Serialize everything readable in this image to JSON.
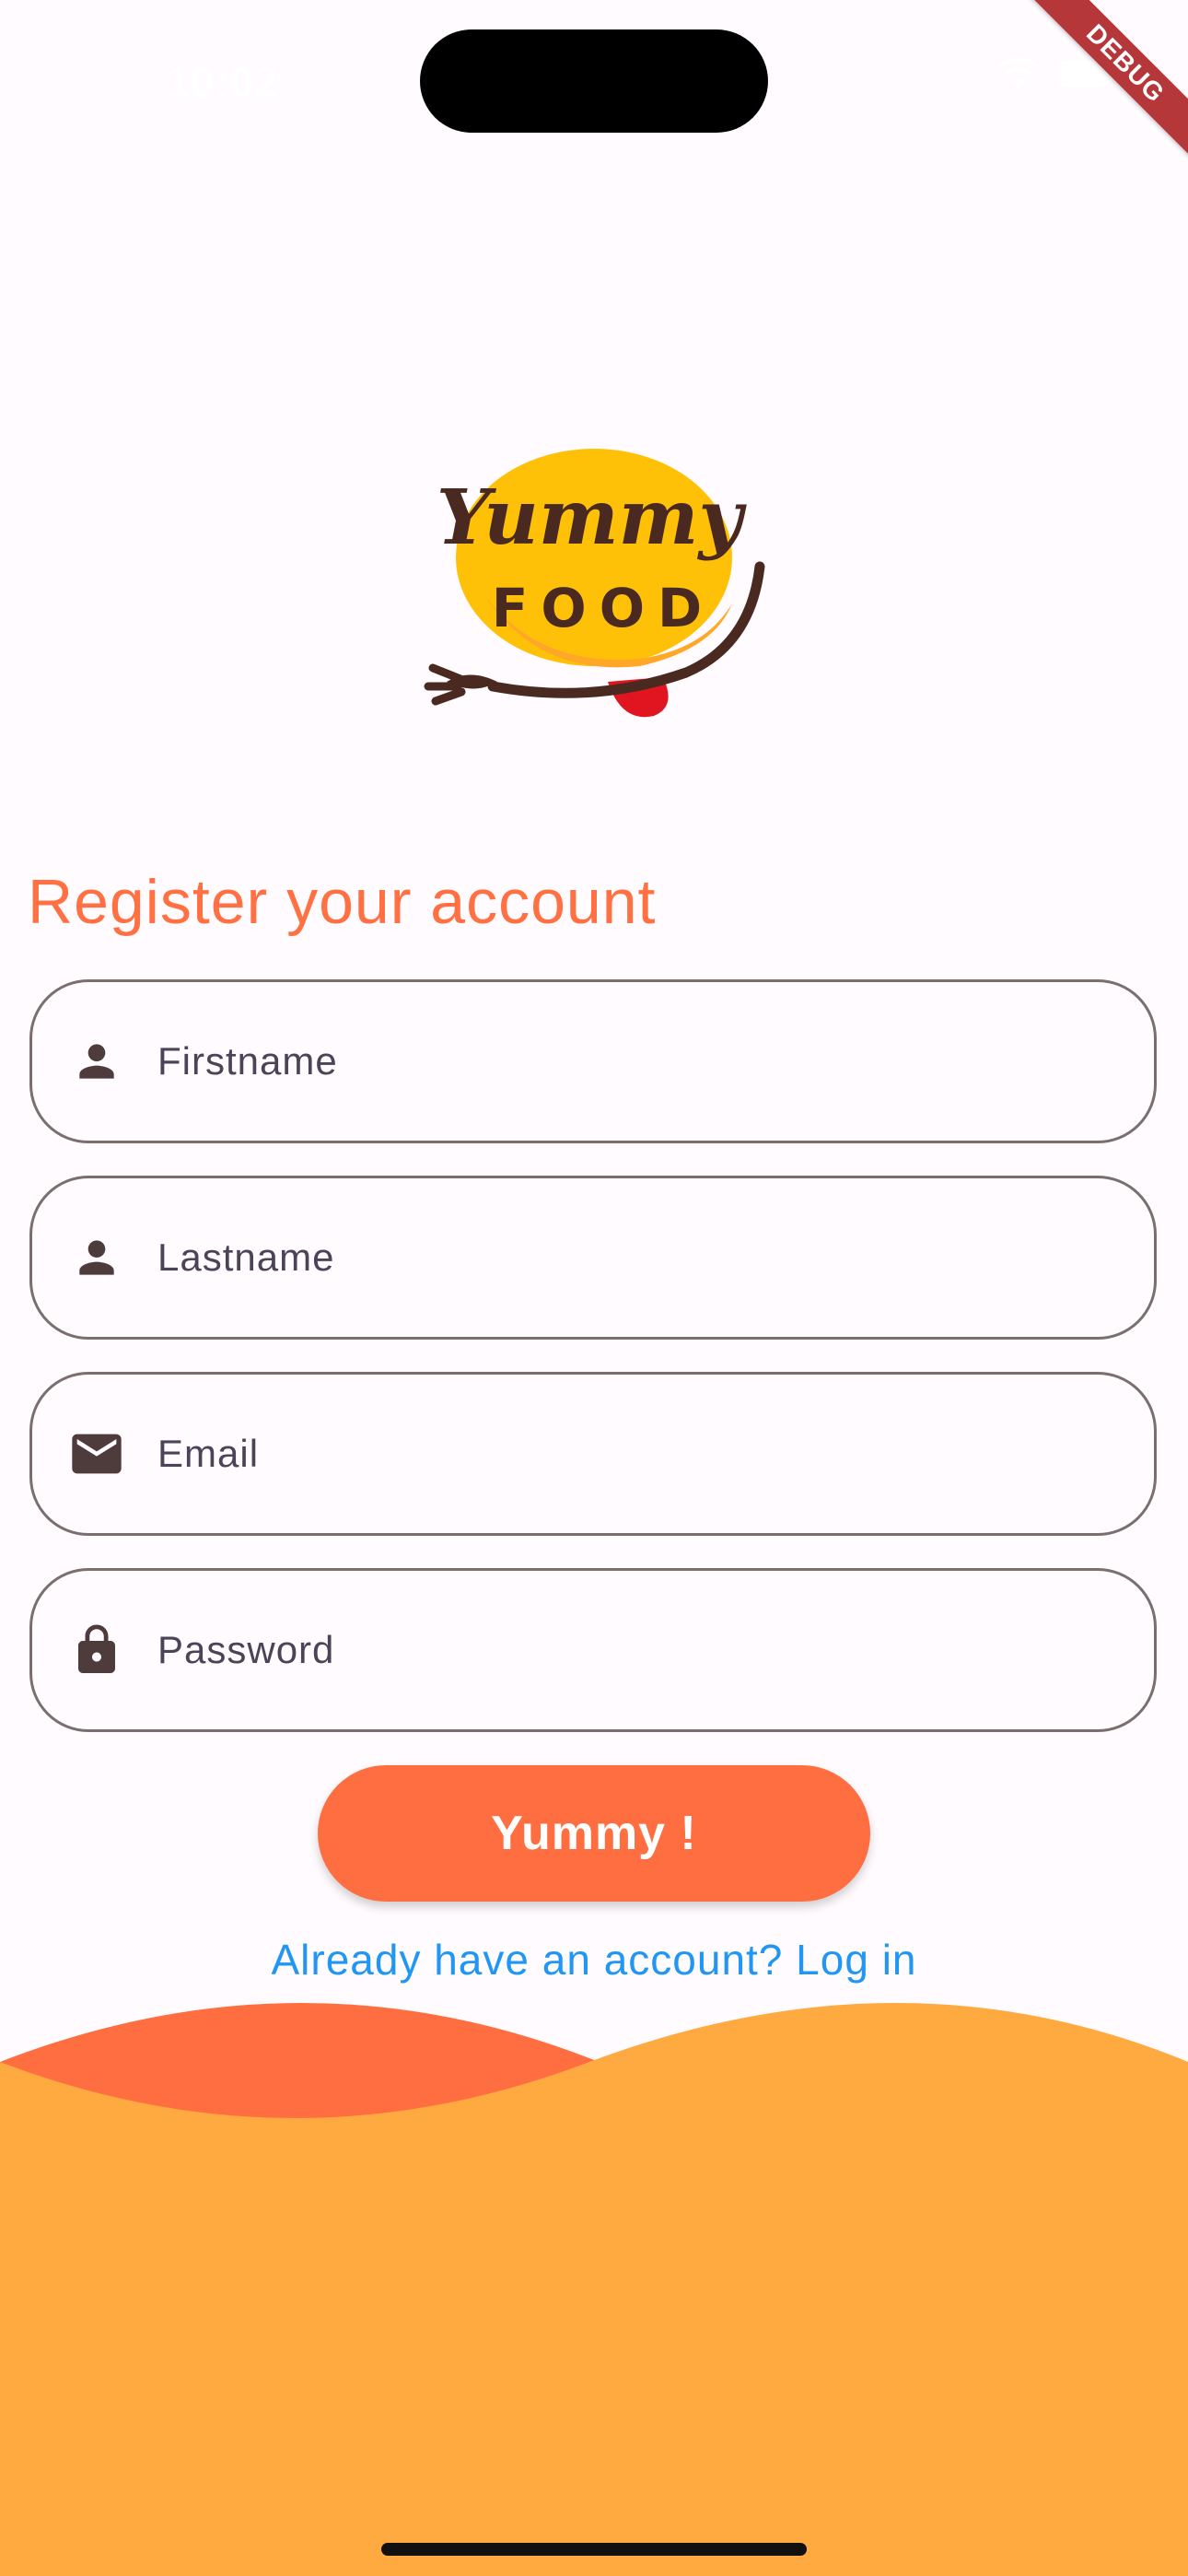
{
  "status_bar": {
    "time": "10:02"
  },
  "debug_banner": {
    "label": "DEBUG"
  },
  "logo": {
    "line1": "Yummy",
    "line2": "FOOD"
  },
  "title": "Register your account",
  "fields": [
    {
      "icon": "person-icon",
      "placeholder": "Firstname",
      "value": ""
    },
    {
      "icon": "person-icon",
      "placeholder": "Lastname",
      "value": ""
    },
    {
      "icon": "mail-icon",
      "placeholder": "Email",
      "value": ""
    },
    {
      "icon": "lock-icon",
      "placeholder": "Password",
      "value": ""
    }
  ],
  "submit_button": {
    "label": "Yummy !"
  },
  "login_link": {
    "label": "Already have an account? Log in"
  },
  "colors": {
    "accent": "#FF7043",
    "button": "#FF6E40",
    "link": "#2196F3",
    "wave_front": "#FFAA40",
    "wave_back": "#FF6E40",
    "background": "#FFFBFE"
  }
}
